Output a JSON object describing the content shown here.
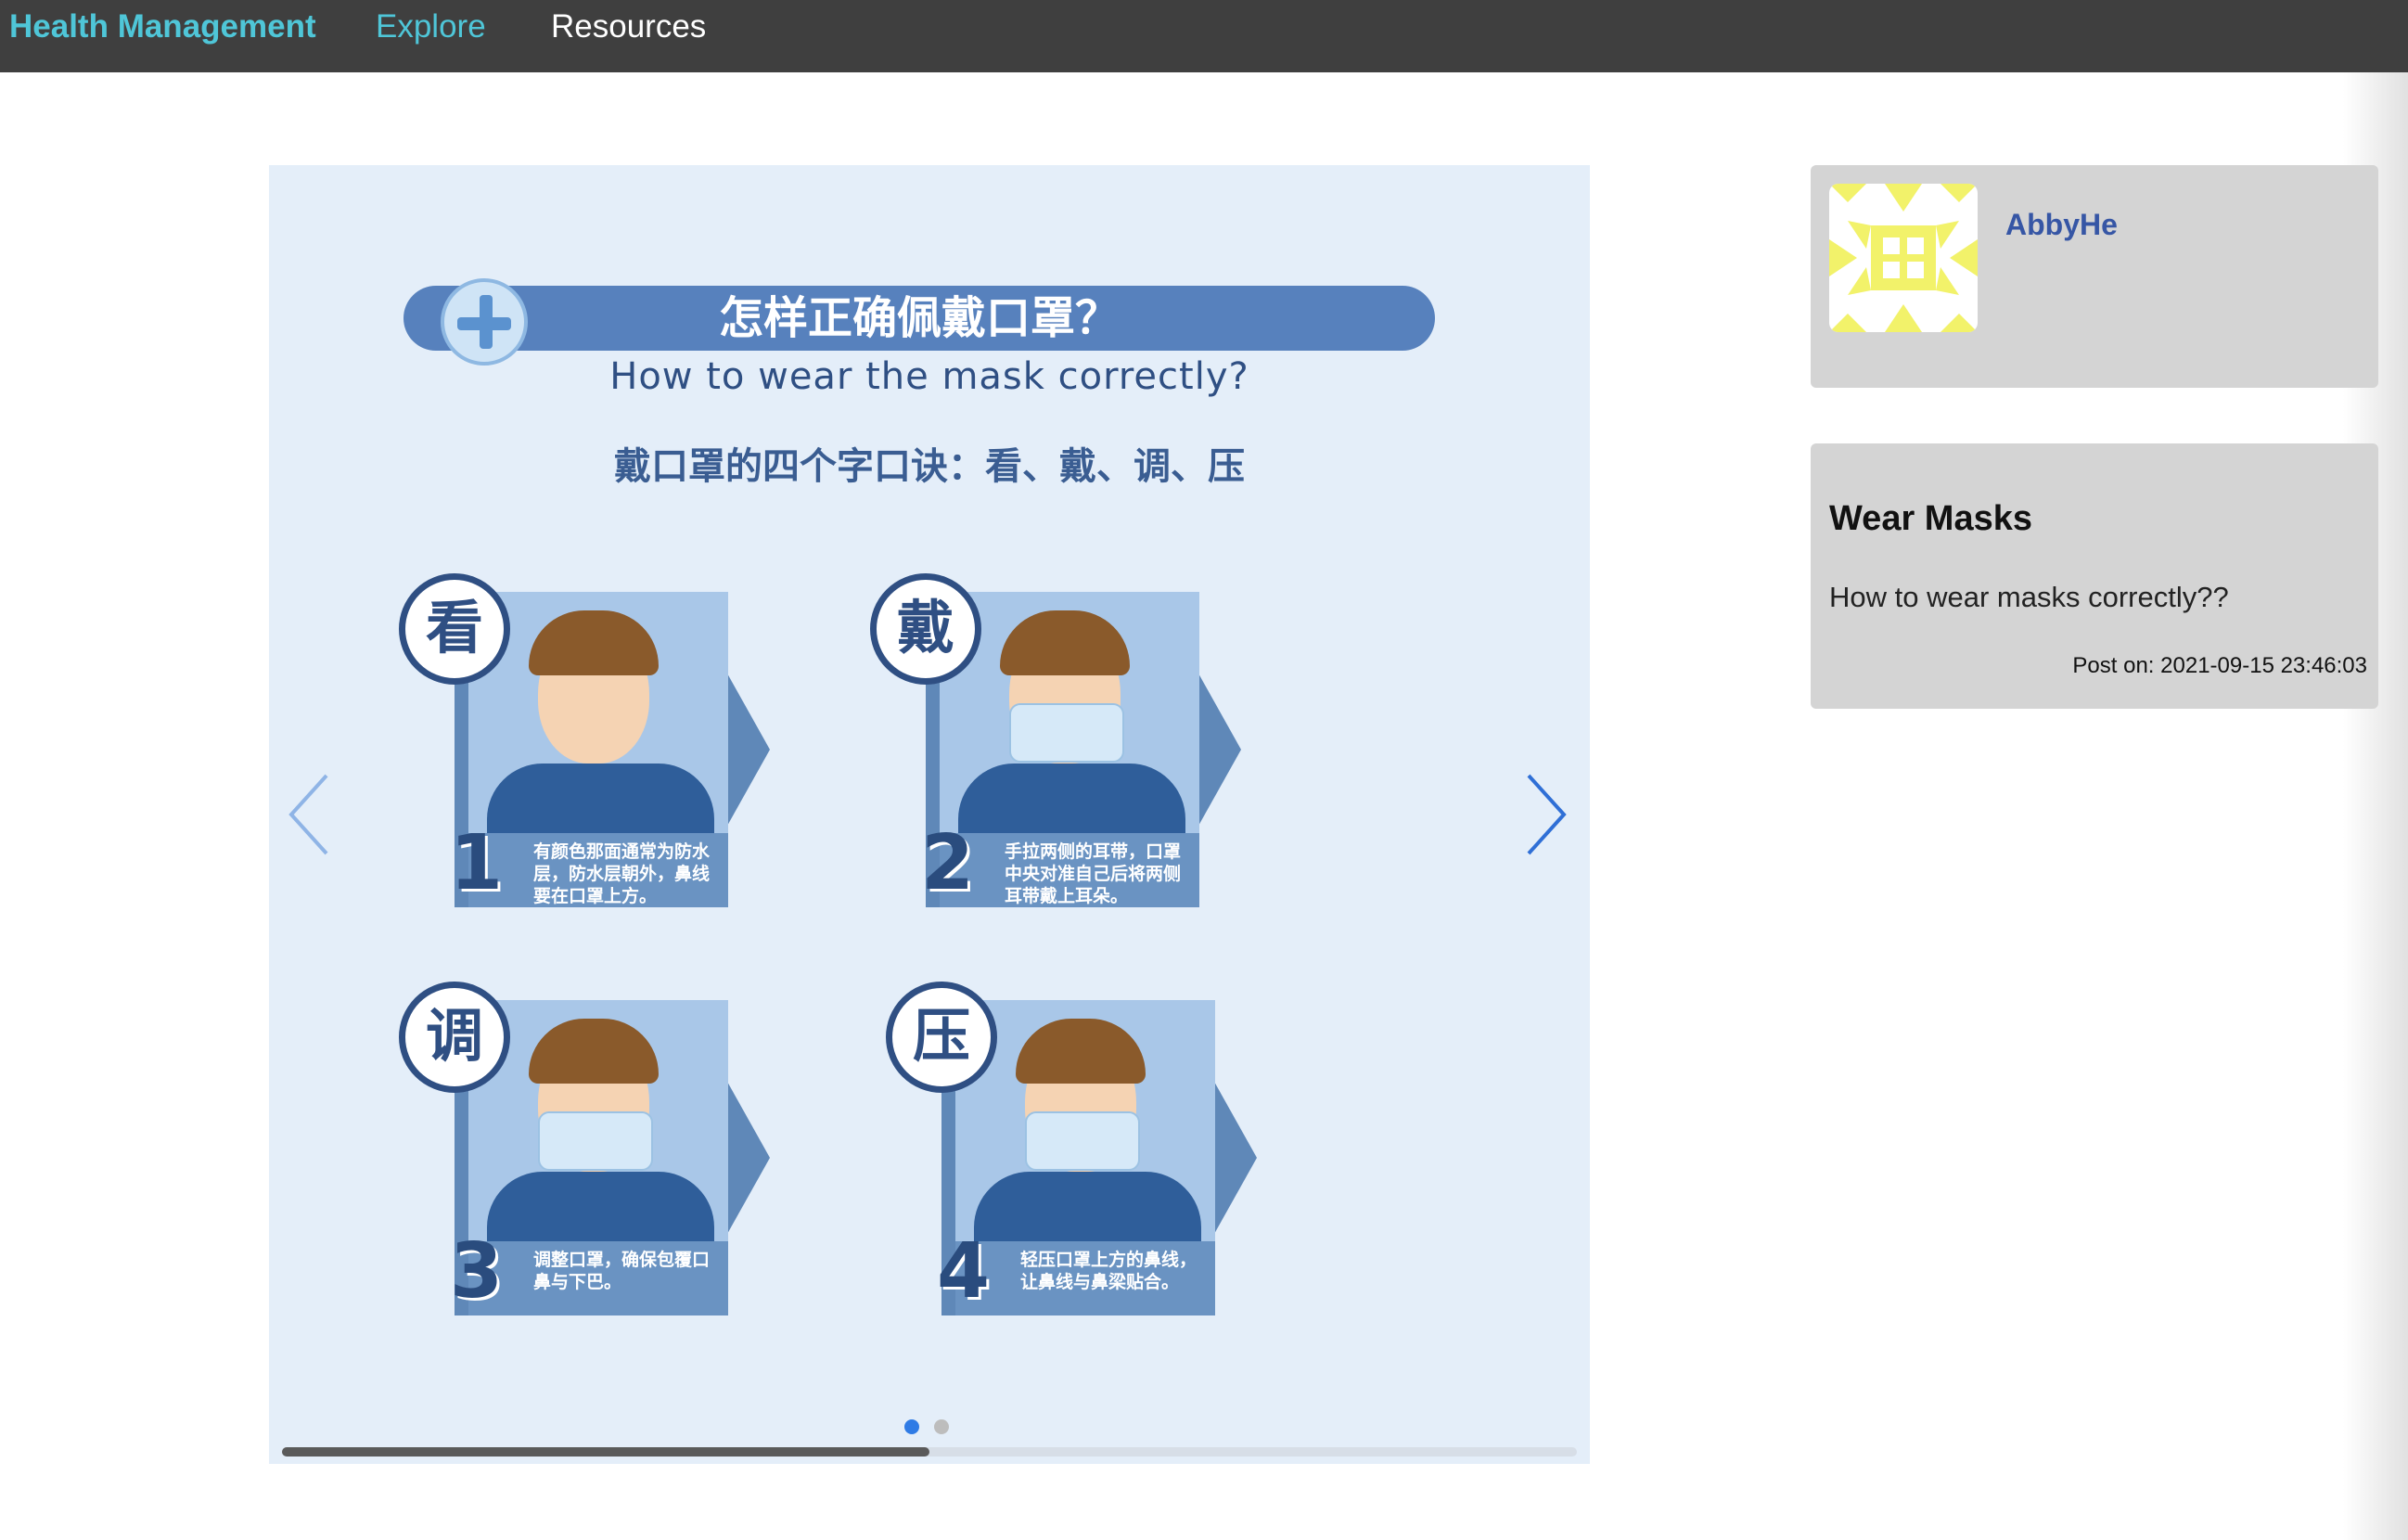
{
  "navbar": {
    "brand": "Health Management",
    "links": [
      "Explore",
      "Resources"
    ]
  },
  "carousel": {
    "slide_title_cn": "怎样正确佩戴口罩？",
    "slide_subtitle_en": "How to wear the mask correctly?",
    "slide_rule_cn": "戴口罩的四个字口诀：看、戴、调、压",
    "steps": [
      {
        "badge": "看",
        "number": "1",
        "caption": "有颜色那面通常为防水层，防水层朝外，鼻线要在口罩上方。"
      },
      {
        "badge": "戴",
        "number": "2",
        "caption": "手拉两侧的耳带，口罩中央对准自己后将两侧耳带戴上耳朵。"
      },
      {
        "badge": "调",
        "number": "3",
        "caption": "调整口罩，确保包覆口鼻与下巴。"
      },
      {
        "badge": "压",
        "number": "4",
        "caption": "轻压口罩上方的鼻线，让鼻线与鼻梁贴合。"
      }
    ],
    "active_slide": 0,
    "slide_count": 2,
    "scroll_progress": 0.5,
    "prev_icon": "chevron-left-icon",
    "next_icon": "chevron-right-icon"
  },
  "author": {
    "name": "AbbyHe",
    "avatar_icon": "identicon-avatar"
  },
  "post": {
    "title": "Wear Masks",
    "body": "How to wear masks correctly??",
    "meta": "Post on:  2021-09-15 23:46:03"
  },
  "colors": {
    "navbar_bg": "#3f3f3f",
    "brand": "#4fc6d8",
    "card_bg": "#d4d4d4",
    "author_link": "#3656a5",
    "carousel_bg": "#e4eef9",
    "dot_active": "#2f7be5",
    "dot_inactive": "#bdbdbd",
    "identicon": "#f2f26a"
  }
}
